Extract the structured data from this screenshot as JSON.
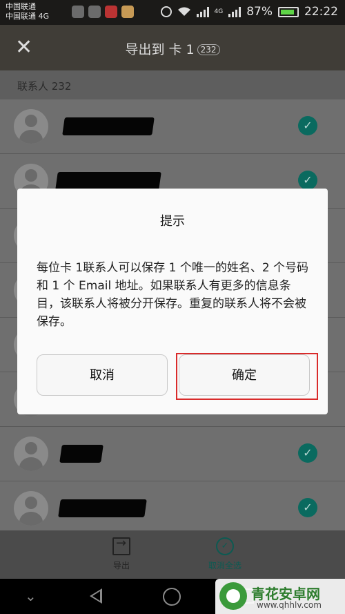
{
  "status_bar": {
    "carrier_1": "中国联通",
    "carrier_2": "中国联通 4G",
    "signal_label": "4G",
    "battery": "87%",
    "time": "22:22"
  },
  "toolbar": {
    "title": "导出到 卡 1",
    "count": "232"
  },
  "list": {
    "section_label": "联系人 232",
    "rows": [
      {
        "redact_width": 130,
        "checked": true
      },
      {
        "redact_width": 150,
        "checked": true
      },
      {
        "redact_width": 100,
        "checked": true
      },
      {
        "redact_width": 120,
        "checked": true
      },
      {
        "redact_width": 110,
        "checked": true
      },
      {
        "redact_width": 140,
        "checked": true
      },
      {
        "redact_width": 60,
        "checked": true
      },
      {
        "redact_width": 125,
        "checked": true
      }
    ]
  },
  "bottom_bar": {
    "export_label": "导出",
    "deselect_label": "取消全选"
  },
  "dialog": {
    "title": "提示",
    "message": "每位卡 1联系人可以保存 1 个唯一的姓名、2 个号码和 1 个 Email 地址。如果联系人有更多的信息条目，该联系人将被分开保存。重复的联系人将不会被保存。",
    "cancel_label": "取消",
    "confirm_label": "确定"
  },
  "watermark": {
    "name": "青花安卓网",
    "url": "www.qhhlv.com"
  },
  "colors": {
    "accent_teal": "#0a6a5f",
    "highlight_red": "#d92b2b"
  }
}
